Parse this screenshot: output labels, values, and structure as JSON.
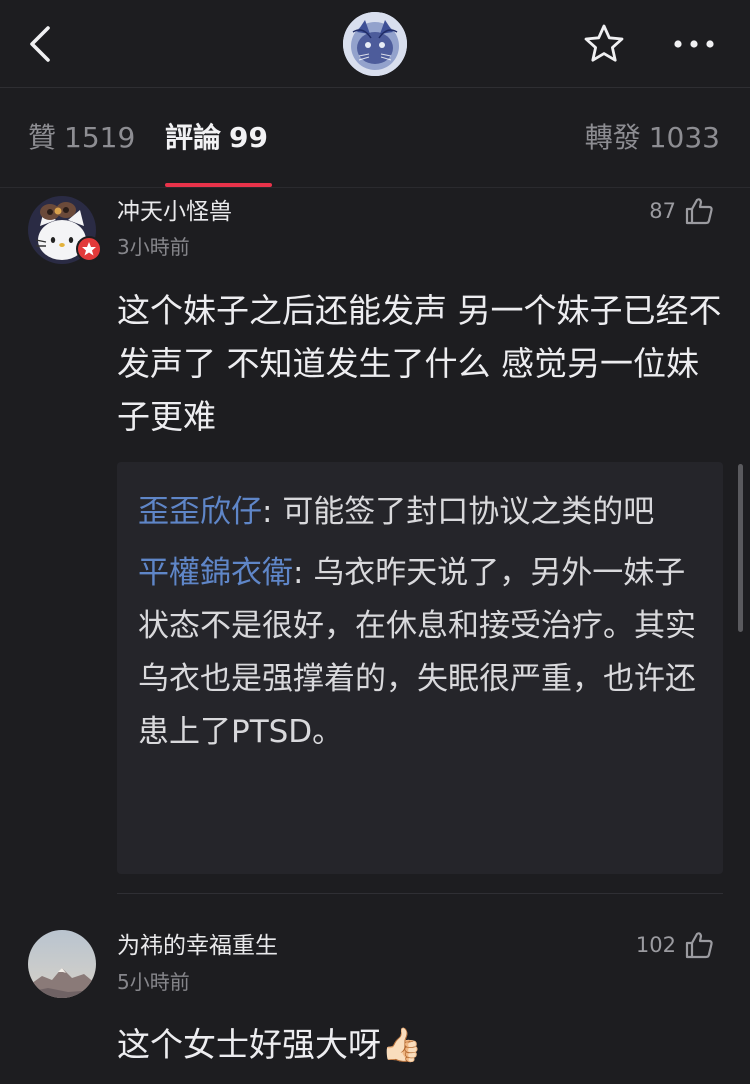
{
  "nav": {
    "back_icon": "chevron-left-icon",
    "star_icon": "star-outline-icon",
    "more_icon": "more-horizontal-icon"
  },
  "tabs": {
    "likes": {
      "label": "贊",
      "count": "1519"
    },
    "comments": {
      "label": "評論",
      "count": "99"
    },
    "reposts": {
      "label": "轉發",
      "count": "1033"
    }
  },
  "comments": [
    {
      "name": "冲天小怪兽",
      "time": "3小時前",
      "likes": "87",
      "body": "这个妹子之后还能发声 另一个妹子已经不发声了 不知道发生了什么 感觉另一位妹子更难",
      "replies": [
        {
          "name": "歪歪欣仔",
          "sep": ": ",
          "text": "可能签了封口协议之类的吧"
        },
        {
          "name": "平權錦衣衛",
          "sep": ": ",
          "text": "乌衣昨天说了，另外一妹子状态不是很好，在休息和接受治疗。其实乌衣也是强撑着的，失眠很严重，也许还患上了PTSD。"
        }
      ]
    },
    {
      "name": "为祎的幸福重生",
      "time": "5小時前",
      "likes": "102",
      "body": "这个女士好强大呀",
      "emoji": "👍🏻"
    }
  ],
  "colors": {
    "background": "#1d1d20",
    "accent": "#e8334a",
    "reply_name": "#5f86c8"
  }
}
